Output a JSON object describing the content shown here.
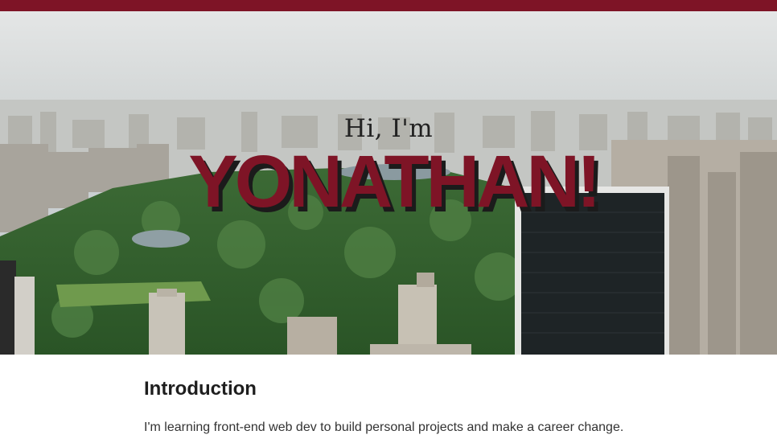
{
  "hero": {
    "greeting": "Hi, I'm",
    "name": "YONATHAN!",
    "image": "city-skyline-park-photo"
  },
  "intro": {
    "title": "Introduction",
    "text": "I'm learning front-end web dev to build personal projects and make a career change."
  },
  "colors": {
    "accent": "#7e1426",
    "text": "#1e1e1e"
  }
}
